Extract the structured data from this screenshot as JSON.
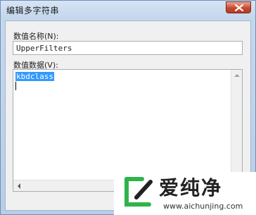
{
  "window": {
    "title": "编辑多字符串"
  },
  "fields": {
    "name_label": "数值名称(N):",
    "name_value": "UpperFilters",
    "data_label": "数值数据(V):",
    "data_value": "kbdclass"
  },
  "watermark": {
    "brand": "爱纯净",
    "url": "www.aichunjing.com",
    "colors": {
      "accent": "#2fb34a",
      "text": "#222222"
    }
  }
}
